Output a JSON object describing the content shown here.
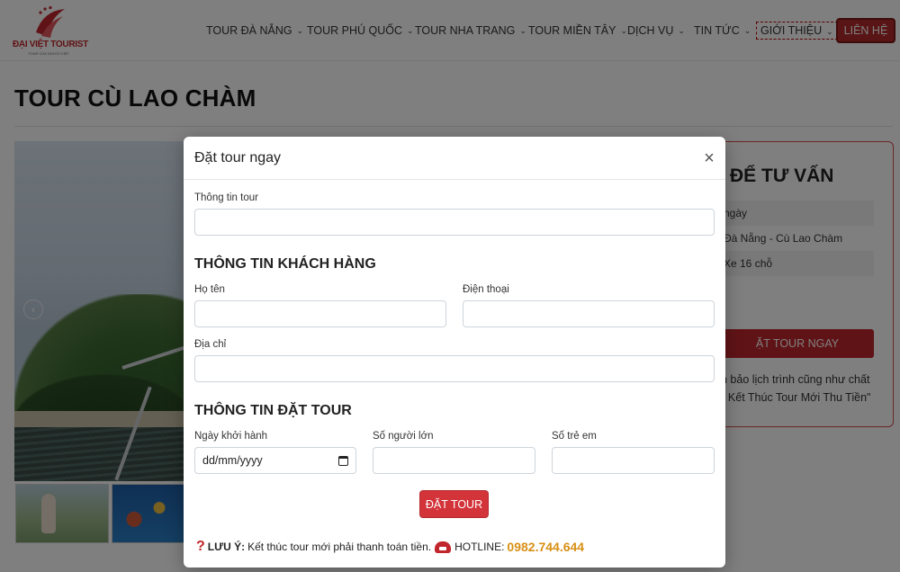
{
  "brand": {
    "name": "ĐẠI VIỆT TOURIST",
    "tagline": "TOUR CỦA NGƯỜI VIỆT"
  },
  "nav": {
    "items": [
      {
        "label": "TOUR ĐÀ NẴNG",
        "icon": "chevron-down-icon"
      },
      {
        "label": "TOUR PHÚ QUỐC",
        "icon": "chevron-down-icon"
      },
      {
        "label": "TOUR NHA TRANG",
        "icon": "chevron-down-icon"
      },
      {
        "label": "TOUR MIỀN TÂY",
        "icon": "chevron-down-icon"
      },
      {
        "label": "DỊCH VỤ",
        "icon": "chevron-down-icon"
      },
      {
        "label": "TIN TỨC",
        "icon": "chevron-down-icon"
      },
      {
        "label": "GIỚI THIỆU",
        "icon": "chevron-down-icon"
      }
    ],
    "cta": "LIÊN HỆ"
  },
  "page": {
    "title": "TOUR CÙ LAO CHÀM"
  },
  "sidebar": {
    "heading": "ĐỂ TƯ VẤN",
    "rows": [
      "ngày",
      "Đà Nẵng - Cù Lao Chàm",
      "Xe 16 chỗ"
    ],
    "book_button": "ẶT TOUR NGAY",
    "note_line1": "n bảo lịch trình cũng như chất",
    "note_line2": "\" Kết Thúc Tour Mới Thu Tiền\""
  },
  "modal": {
    "title": "Đặt tour ngay",
    "close": "×",
    "tour_info": {
      "label": "Thông tin tour",
      "value": ""
    },
    "customer_section": "THÔNG TIN KHÁCH HÀNG",
    "name": {
      "label": "Họ tên",
      "value": ""
    },
    "phone": {
      "label": "Điện thoại",
      "value": ""
    },
    "address": {
      "label": "Địa chỉ",
      "value": ""
    },
    "booking_section": "THÔNG TIN ĐẶT TOUR",
    "start_date": {
      "label": "Ngày khởi hành",
      "placeholder": "dd/mm/yyyy"
    },
    "adults": {
      "label": "Số người lớn",
      "value": ""
    },
    "children": {
      "label": "Số trẻ em",
      "value": ""
    },
    "submit": "ĐẶT TOUR",
    "notice": {
      "prefix": "LƯU Ý:",
      "text": "Kết thúc tour mới phải thanh toán tiền.",
      "hotline_label": "HOTLINE:",
      "hotline_number": "0982.744.644"
    }
  },
  "colors": {
    "accent": "#c1262c",
    "hotline": "#d89015",
    "overlay": "rgba(0,0,0,0.5)"
  }
}
